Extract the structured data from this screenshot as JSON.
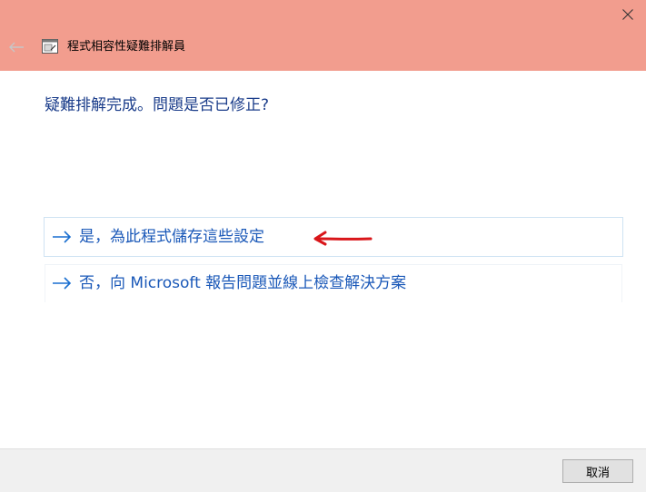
{
  "window": {
    "title": "程式相容性疑難排解員",
    "accent_color": "#f29d8e"
  },
  "header": {
    "back_icon": "back-arrow-icon",
    "app_icon": "troubleshooter-app-icon",
    "close_icon": "close-icon"
  },
  "content": {
    "question": "疑難排解完成。問題是否已修正?",
    "options": [
      {
        "label": "是，為此程式儲存這些設定",
        "icon": "right-arrow-icon"
      },
      {
        "label": "否，向 Microsoft 報告問題並線上檢查解決方案",
        "icon": "right-arrow-icon"
      }
    ],
    "annotation": {
      "icon": "red-pointer-arrow-icon",
      "color": "#d9161a"
    }
  },
  "footer": {
    "cancel_label": "取消"
  }
}
